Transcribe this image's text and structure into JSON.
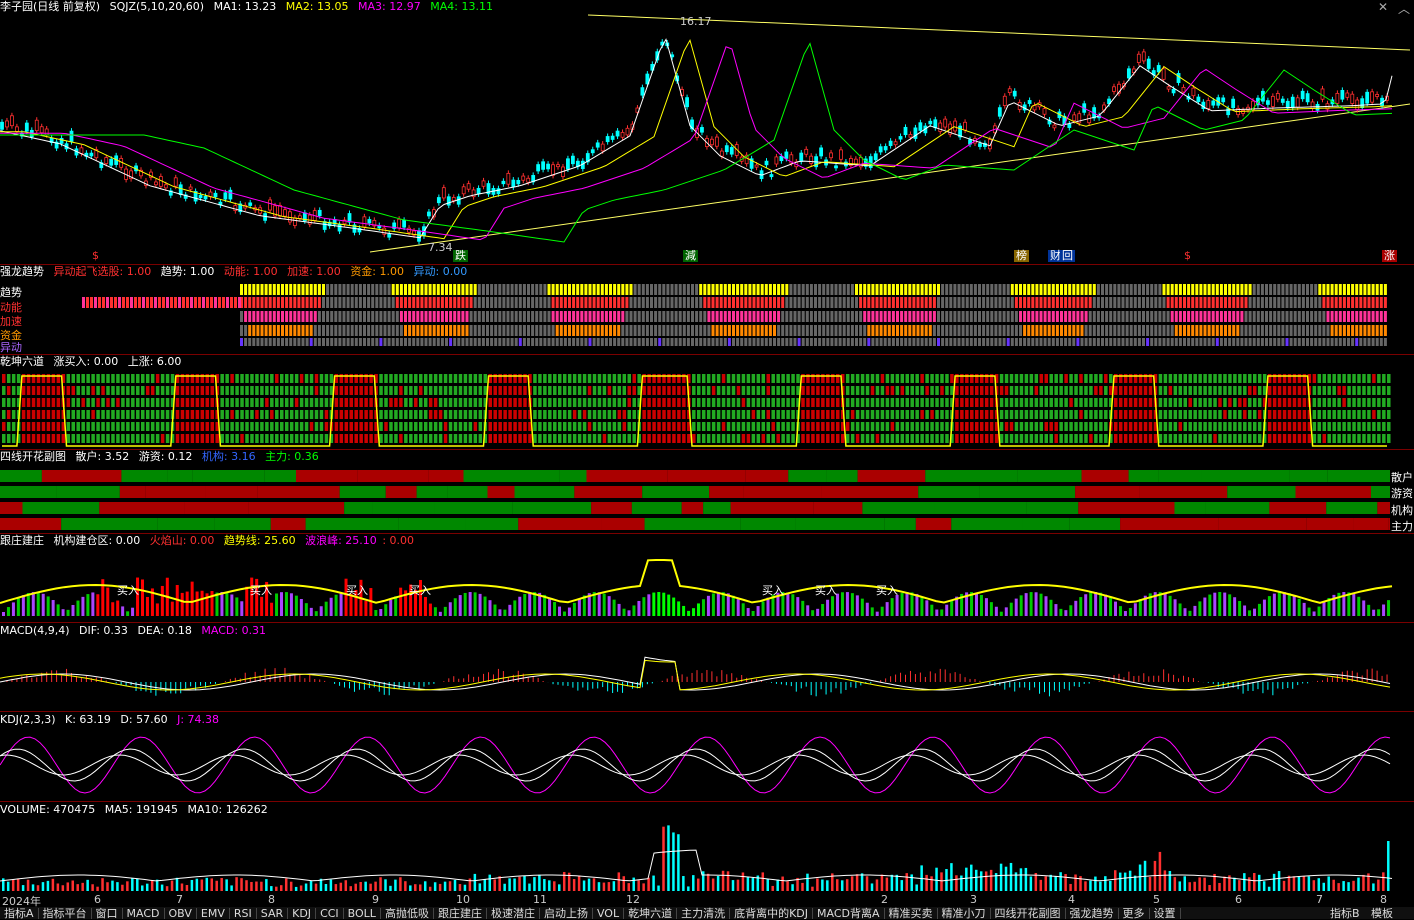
{
  "main": {
    "stock_title": "李子园(日线 前复权)",
    "indicator": "SQJZ(5,10,20,60)",
    "ma1": "MA1: 13.23",
    "ma2": "MA2: 13.05",
    "ma3": "MA3: 12.97",
    "ma4": "MA4: 13.11",
    "high_label": "16.17",
    "low_label": "7.34",
    "colors": {
      "ma1": "#ffffff",
      "ma2": "#ffff00",
      "ma3": "#ff00ff",
      "ma4": "#00ff00"
    }
  },
  "events": [
    "$",
    "跌",
    "減",
    "榜",
    "财",
    "回",
    "$",
    "涨"
  ],
  "qlqs": {
    "title": "强龙趋势",
    "p1": "异动起飞选股: 1.00",
    "p2": "趋势: 1.00",
    "p3": "动能: 1.00",
    "p4": "加速: 1.00",
    "p5": "资金: 1.00",
    "p6": "异动: 0.00",
    "rows": [
      "趋势",
      "动能",
      "加速",
      "资金",
      "异动"
    ]
  },
  "qkld": {
    "title": "乾坤六道",
    "p1": "涨买入: 0.00",
    "p2": "上涨: 6.00"
  },
  "sxkh": {
    "title": "四线开花副图",
    "p1": "散户: 3.52",
    "p2": "游资: 0.12",
    "p3": "机构: 3.16",
    "p4": "主力: 0.36",
    "right": [
      "散户",
      "游资",
      "机构",
      "主力"
    ]
  },
  "gzjz": {
    "title": "跟庄建庄",
    "p1": "机构建仓区: 0.00",
    "p2": "火焰山: 0.00",
    "p3": "趋势线: 25.60",
    "p4": "波浪峰: 25.10",
    "p5": ": 0.00",
    "buy": "买入"
  },
  "macd": {
    "title": "MACD(4,9,4)",
    "dif": "DIF: 0.33",
    "dea": "DEA: 0.18",
    "macd": "MACD: 0.31"
  },
  "kdj": {
    "title": "KDJ(2,3,3)",
    "k": "K: 63.19",
    "d": "D: 57.60",
    "j": "J: 74.38"
  },
  "volume": {
    "title": "VOLUME: 470475",
    "ma5": "MA5: 191945",
    "ma10": "MA10: 126262"
  },
  "xaxis": [
    "2024年",
    "6",
    "7",
    "8",
    "9",
    "10",
    "11",
    "12",
    "2",
    "3",
    "4",
    "5",
    "6",
    "7",
    "8"
  ],
  "tabs": [
    "指标A",
    "指标平台",
    "窗口",
    "MACD",
    "OBV",
    "EMV",
    "RSI",
    "SAR",
    "KDJ",
    "CCI",
    "BOLL",
    "高抛低吸",
    "跟庄建庄",
    "极速潜庄",
    "启动上扬",
    "VOL",
    "乾坤六道",
    "主力清洗",
    "底背离中的KDJ",
    "MACD背离A",
    "精准买卖",
    "精准小刀",
    "四线开花副图",
    "强龙趋势",
    "更多",
    "设置"
  ],
  "tabs_right": [
    "指标B",
    "模板"
  ]
}
